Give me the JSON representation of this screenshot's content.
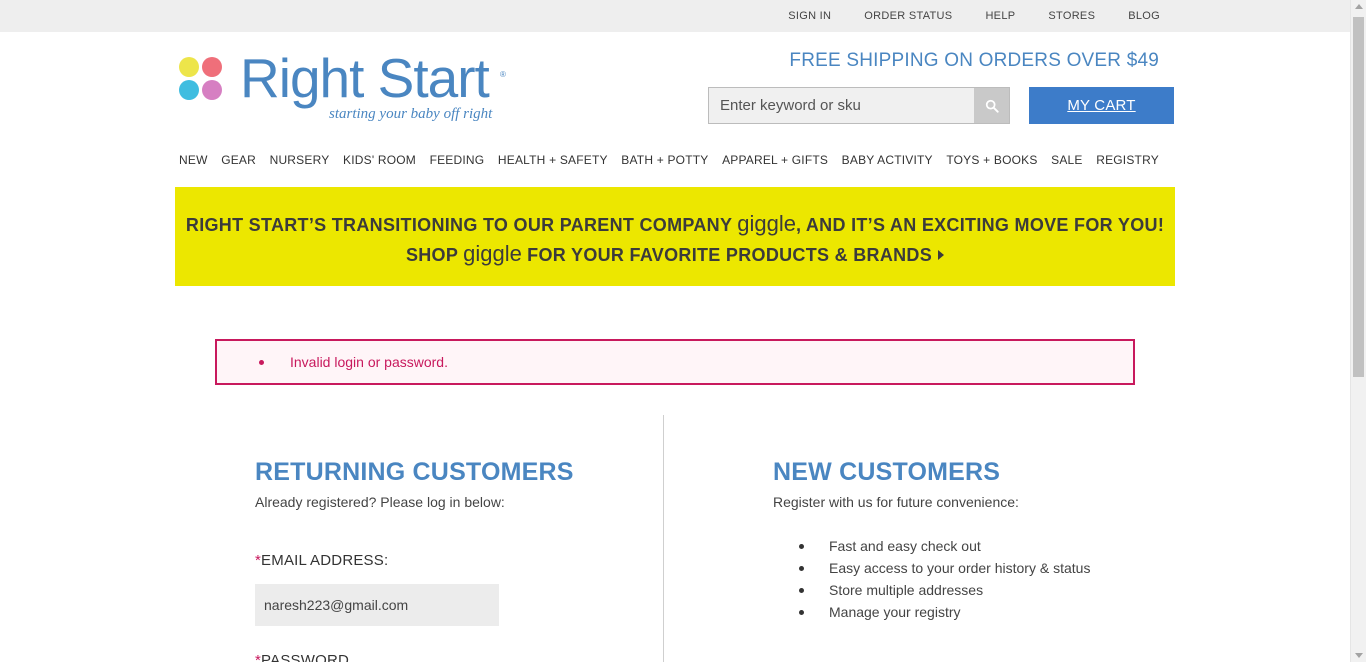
{
  "topbar": {
    "links": [
      "SIGN IN",
      "ORDER STATUS",
      "HELP",
      "STORES",
      "BLOG"
    ]
  },
  "logo": {
    "wordmark": "Right Start",
    "registered": "®",
    "tagline": "starting your baby off right"
  },
  "header": {
    "shipping": "FREE SHIPPING ON ORDERS OVER $49",
    "search_placeholder": "Enter keyword or sku",
    "search_icon": "search-icon",
    "cart_label": "MY CART"
  },
  "nav": {
    "items": [
      "NEW",
      "GEAR",
      "NURSERY",
      "KIDS' ROOM",
      "FEEDING",
      "HEALTH + SAFETY",
      "BATH + POTTY",
      "APPAREL + GIFTS",
      "BABY ACTIVITY",
      "TOYS + BOOKS",
      "SALE",
      "REGISTRY"
    ]
  },
  "banner": {
    "line1_a": "RIGHT START’S TRANSITIONING TO OUR PARENT COMPANY ",
    "line1_brand": "giggle",
    "line1_b": ", AND IT’S AN EXCITING MOVE FOR YOU!",
    "line2_a": "SHOP ",
    "line2_brand": "giggle",
    "line2_b": " FOR YOUR FAVORITE PRODUCTS & BRANDS",
    "background": "#ece700"
  },
  "error": {
    "message": "Invalid login or password.",
    "color": "#c8195d"
  },
  "returning": {
    "title": "RETURNING CUSTOMERS",
    "subtitle": "Already registered? Please log in below:",
    "required_mark": "*",
    "email_label": "EMAIL ADDRESS:",
    "email_value": "naresh223@gmail.com",
    "password_label": "PASSWORD"
  },
  "new_customers": {
    "title": "NEW CUSTOMERS",
    "subtitle": "Register with us for future convenience:",
    "benefits": [
      "Fast and easy check out",
      "Easy access to your order history & status",
      "Store multiple addresses",
      "Manage your registry"
    ]
  },
  "colors": {
    "brand_blue": "#4a86c1",
    "cart_blue": "#3d7cc9"
  }
}
